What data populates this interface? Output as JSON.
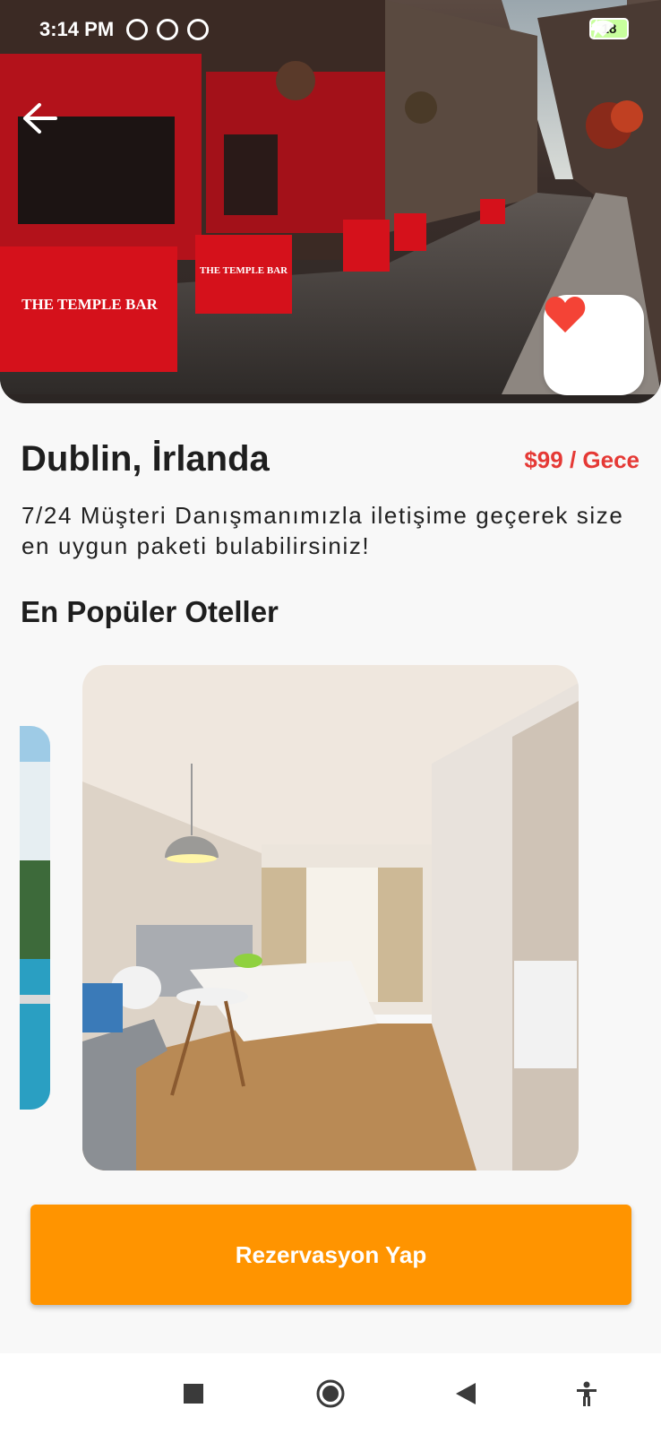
{
  "status_bar": {
    "time": "3:14 PM",
    "battery_level": "18",
    "icons": [
      "alarm-icon",
      "sync-icon",
      "sync-icon",
      "wifi-icon",
      "battery-icon",
      "charging-icon"
    ]
  },
  "hero": {
    "sign_text": "THE TEMPLE BAR",
    "back_icon": "arrow-left-icon",
    "favorite_icon": "heart-icon",
    "favorite_color": "#f44336"
  },
  "destination": {
    "title": "Dublin, İrlanda",
    "price": "$99 / Gece",
    "description": "7/24 Müşteri Danışmanımızla iletişime geçerek size en uygun paketi bulabilirsiniz!"
  },
  "hotels_section": {
    "title": "En Popüler Oteller"
  },
  "reserve_button": {
    "label": "Rezervasyon Yap",
    "color": "#ff9400"
  },
  "nav_bar": {
    "icons": [
      "recents-icon",
      "home-icon",
      "back-icon",
      "accessibility-icon"
    ]
  },
  "colors": {
    "accent": "#ff9400",
    "price": "#e53935",
    "text": "#1e1e1e"
  }
}
